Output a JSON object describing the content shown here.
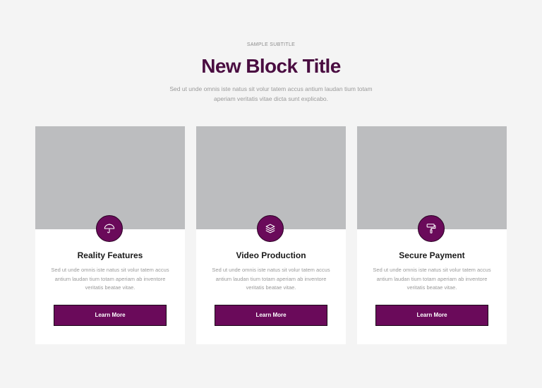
{
  "header": {
    "subtitle": "SAMPLE SUBTITLE",
    "title": "New Block Title",
    "description": "Sed ut unde omnis iste natus sit volur tatem accus antium laudan tium totam aperiam veritatis vitae dicta sunt explicabo."
  },
  "cards": [
    {
      "icon": "umbrella-icon",
      "title": "Reality Features",
      "text": "Sed ut unde omnis iste natus sit volur tatem accus antium laudan tium totam aperiam ab inventore veritatis beatae vitae.",
      "button_label": "Learn More"
    },
    {
      "icon": "layers-icon",
      "title": "Video Production",
      "text": "Sed ut unde omnis iste natus sit volur tatem accus antium laudan tium totam aperiam ab inventore veritatis beatae vitae.",
      "button_label": "Learn More"
    },
    {
      "icon": "paint-roller-icon",
      "title": "Secure Payment",
      "text": "Sed ut unde omnis iste natus sit volur tatem accus antium laudan tium totam aperiam ab inventore veritatis beatae vitae.",
      "button_label": "Learn More"
    }
  ],
  "colors": {
    "accent": "#6a0a5a",
    "title": "#4a0d41",
    "image_placeholder": "#bcbdbf",
    "background": "#f4f4f4"
  }
}
